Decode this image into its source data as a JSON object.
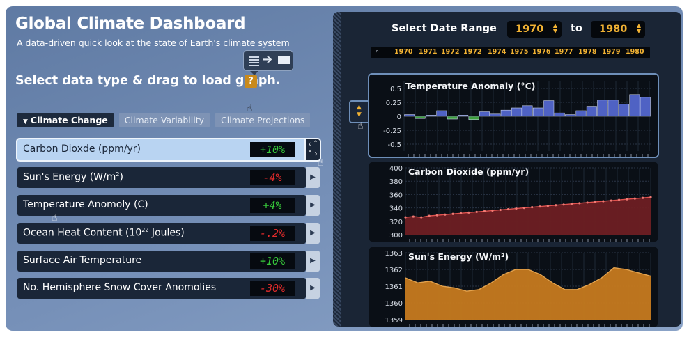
{
  "header": {
    "title": "Global Climate Dashboard",
    "subtitle": "A data-driven quick look at the state of Earth's climate system",
    "instruction": "Select data type & drag to load graph.",
    "help_label": "?"
  },
  "tabs": [
    {
      "label": "Climate Change",
      "active": true
    },
    {
      "label": "Climate Variability",
      "active": false
    },
    {
      "label": "Climate Projections",
      "active": false
    }
  ],
  "data_items": [
    {
      "label": "Carbon Dioxde (ppm/yr)",
      "sup": "",
      "label_suffix": "",
      "value": "+10%",
      "sign": "pos",
      "selected": true
    },
    {
      "label": "Sun's Energy (W/m",
      "sup": "2",
      "label_suffix": ")",
      "value": "-4%",
      "sign": "neg",
      "selected": false
    },
    {
      "label": "Temperature Anomoly (C)",
      "sup": "",
      "label_suffix": "",
      "value": "+4%",
      "sign": "pos",
      "selected": false
    },
    {
      "label": "Ocean Heat Content (10",
      "sup": "22",
      "label_suffix": " Joules)",
      "value": "-.2%",
      "sign": "neg",
      "selected": false
    },
    {
      "label": "Surface Air Temperature",
      "sup": "",
      "label_suffix": "",
      "value": "+10%",
      "sign": "pos",
      "selected": false
    },
    {
      "label": "No. Hemisphere Snow Cover Anomolies",
      "sup": "",
      "label_suffix": "",
      "value": "-30%",
      "sign": "neg",
      "selected": false
    }
  ],
  "date_range": {
    "label": "Select Date Range",
    "from": "1970",
    "to_label": "to",
    "to": "1980"
  },
  "timeline_years": [
    "1970",
    "1971",
    "1972",
    "1972",
    "1974",
    "1975",
    "1976",
    "1977",
    "1978",
    "1979",
    "1980"
  ],
  "colors": {
    "accent": "#f1b233",
    "positive": "#37c93a",
    "negative": "#e02b2b",
    "temp_pos": "#4f62c4",
    "temp_neg": "#3fa13f",
    "co2_fill": "#6e1f23",
    "co2_line": "#e0524e",
    "sun_fill": "#c67a1f"
  },
  "icons": {
    "drag_hint": "drag-list-to-graph-icon",
    "go": "play-arrow-icon",
    "scroll": "scroll-updown-icon",
    "search": "magnifier-icon",
    "cursor": "hand-pointer-icon"
  },
  "chart_data": [
    {
      "type": "bar",
      "title": "Temperature Anomaly (°C)",
      "ylim": [
        -0.6,
        0.6
      ],
      "yticks": [
        "0.5",
        "0.25",
        "0",
        "-0.25",
        "-0.5"
      ],
      "ytick_values": [
        0.5,
        0.25,
        0,
        -0.25,
        -0.5
      ],
      "values": [
        0.03,
        -0.04,
        0.02,
        0.1,
        -0.05,
        0.02,
        -0.06,
        0.08,
        0.04,
        0.11,
        0.15,
        0.19,
        0.15,
        0.28,
        0.06,
        0.03,
        0.1,
        0.18,
        0.29,
        0.29,
        0.22,
        0.39,
        0.34
      ]
    },
    {
      "type": "area",
      "title": "Carbon Dioxide (ppm/yr)",
      "ylim": [
        300,
        400
      ],
      "yticks": [
        "400",
        "380",
        "360",
        "340",
        "320",
        "300"
      ],
      "ytick_values": [
        400,
        380,
        360,
        340,
        320,
        300
      ],
      "values": [
        326,
        327,
        326,
        328,
        329,
        330,
        331,
        332,
        333,
        334,
        335,
        336,
        337,
        338,
        339,
        340,
        341,
        342,
        343,
        344,
        345,
        346,
        347,
        348,
        349,
        350,
        351,
        352,
        353,
        354,
        355,
        356
      ]
    },
    {
      "type": "area",
      "title": "Sun's Energy (W/m²)",
      "ylim": [
        1359,
        1363
      ],
      "yticks": [
        "1363",
        "1362",
        "1361",
        "1360",
        "1359"
      ],
      "ytick_values": [
        1363,
        1362,
        1361,
        1360,
        1359
      ],
      "values": [
        1361.5,
        1361.2,
        1361.3,
        1361.0,
        1360.9,
        1360.7,
        1360.8,
        1361.2,
        1361.7,
        1362.0,
        1362.0,
        1361.7,
        1361.2,
        1360.8,
        1360.8,
        1361.1,
        1361.5,
        1362.1,
        1362.0,
        1361.8,
        1361.6
      ]
    }
  ]
}
